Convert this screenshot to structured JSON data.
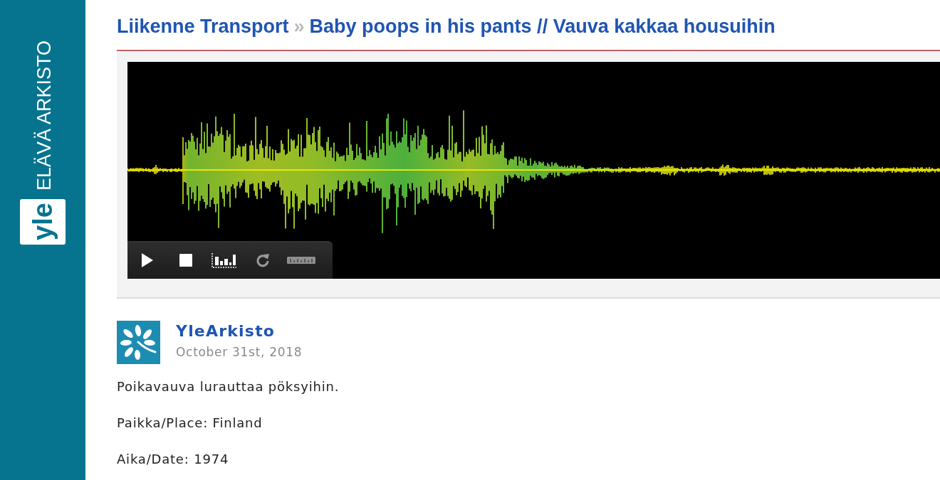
{
  "sidebar": {
    "brand_text": "ELÄVÄ ARKISTO",
    "logo_text": "yle"
  },
  "breadcrumb": {
    "parent": "Liikenne Transport",
    "separator": "»",
    "title": "Baby poops in his pants // Vauva kakkaa housuihin"
  },
  "player": {
    "controls": [
      {
        "kind": "play"
      },
      {
        "kind": "stop"
      },
      {
        "kind": "spectrum"
      },
      {
        "kind": "replay"
      },
      {
        "kind": "ruler"
      }
    ]
  },
  "post": {
    "author": "YleArkisto",
    "date": "October 31st, 2018",
    "paragraphs": [
      "Poikavauva lurauttaa pöksyihin.",
      "Paikka/Place: Finland",
      "Aika/Date: 1974"
    ]
  }
}
